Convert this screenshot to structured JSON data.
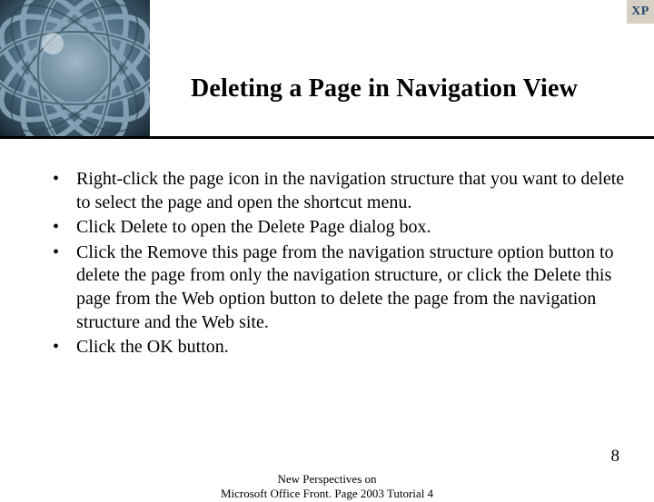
{
  "header": {
    "title": "Deleting a Page in Navigation View",
    "badge": "XP"
  },
  "bullets": [
    "Right-click the page icon in the navigation structure that you want to delete to select the page and open the shortcut menu.",
    "Click Delete to open the Delete Page dialog box.",
    "Click the Remove this page from the navigation structure option button to delete the page from only the navigation structure, or click the Delete this page from the Web option button to delete the page from the navigation structure and the Web site.",
    "Click the OK button."
  ],
  "footer": {
    "line1": "New Perspectives on",
    "line2": "Microsoft Office Front. Page 2003 Tutorial 4",
    "page_number": "8"
  }
}
